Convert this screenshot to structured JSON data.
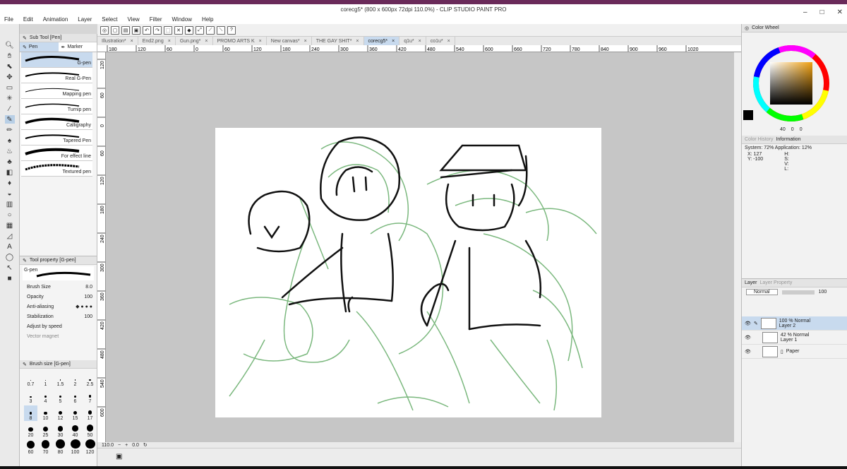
{
  "window": {
    "title": "corecg5* (800 x 600px 72dpi 110.0%) - CLIP STUDIO PAINT PRO"
  },
  "menu": [
    "File",
    "Edit",
    "Animation",
    "Layer",
    "Select",
    "View",
    "Filter",
    "Window",
    "Help"
  ],
  "doc_tabs": [
    "Illustration*",
    "End2.png",
    "Gun.png*",
    "PROMO ARTS K",
    "New canvas*",
    "THE GAY SHIT*",
    "corecg5*",
    "q1u*",
    "co1u*"
  ],
  "active_tab": "corecg5*",
  "ruler_ticks": [
    "180",
    "120",
    "60",
    "0",
    "60",
    "120",
    "180",
    "240",
    "300",
    "360",
    "420",
    "480",
    "540",
    "600",
    "660",
    "720",
    "780",
    "840",
    "900",
    "960",
    "1020"
  ],
  "ruler_left_ticks": [
    "120",
    "60",
    "0",
    "60",
    "120",
    "180",
    "240",
    "300",
    "360",
    "420",
    "480",
    "540",
    "600"
  ],
  "subtool": {
    "title": "Sub Tool [Pen]",
    "tabs": [
      "Pen",
      "Marker"
    ],
    "brushes": [
      "G-pen",
      "Real G-Pen",
      "Mapping pen",
      "Turnip pen",
      "Calligraphy",
      "Tapered Pen",
      "For effect line",
      "Textured pen"
    ]
  },
  "toolprop": {
    "title": "Tool property [G-pen]",
    "brush_name": "G-pen",
    "brush_size_label": "Brush Size",
    "brush_size": "8.0",
    "opacity_label": "Opacity",
    "opacity": "100",
    "aa_label": "Anti-aliasing",
    "stab_label": "Stabilization",
    "stab": "100",
    "adjust": "Adjust by speed",
    "vector": "Vector magnet"
  },
  "brushsize": {
    "title": "Brush size [G-pen]",
    "sizes": [
      "0.7",
      "1",
      "1.5",
      "2",
      "2.5",
      "3",
      "4",
      "5",
      "6",
      "7",
      "8",
      "10",
      "12",
      "15",
      "17",
      "20",
      "25",
      "30",
      "40",
      "50",
      "60",
      "70",
      "80",
      "100",
      "120"
    ]
  },
  "status": {
    "zoom": "110.0",
    "angle": "0.0"
  },
  "right": {
    "colorwheel_tab": "Color Wheel",
    "hsv": [
      "40",
      "0",
      "0"
    ],
    "colorhistory_tab": "Color History",
    "info_tab": "Information",
    "system": "System: 72% Application: 12%",
    "x": "X: 127",
    "y": "Y: -100",
    "h": "H:",
    "s": "S:",
    "v": "V:",
    "l": "L:"
  },
  "layers": {
    "tab1": "Layer",
    "tab2": "Layer Property",
    "blend": "Normal",
    "opacity": "100",
    "items": [
      {
        "mode": "100 % Normal",
        "name": "Layer 2"
      },
      {
        "mode": "42 % Normal",
        "name": "Layer 1"
      },
      {
        "mode": "",
        "name": "Paper"
      }
    ]
  },
  "colors": {
    "accent": "#c8daee",
    "sketch": "#7bb87e",
    "ink": "#111111"
  }
}
